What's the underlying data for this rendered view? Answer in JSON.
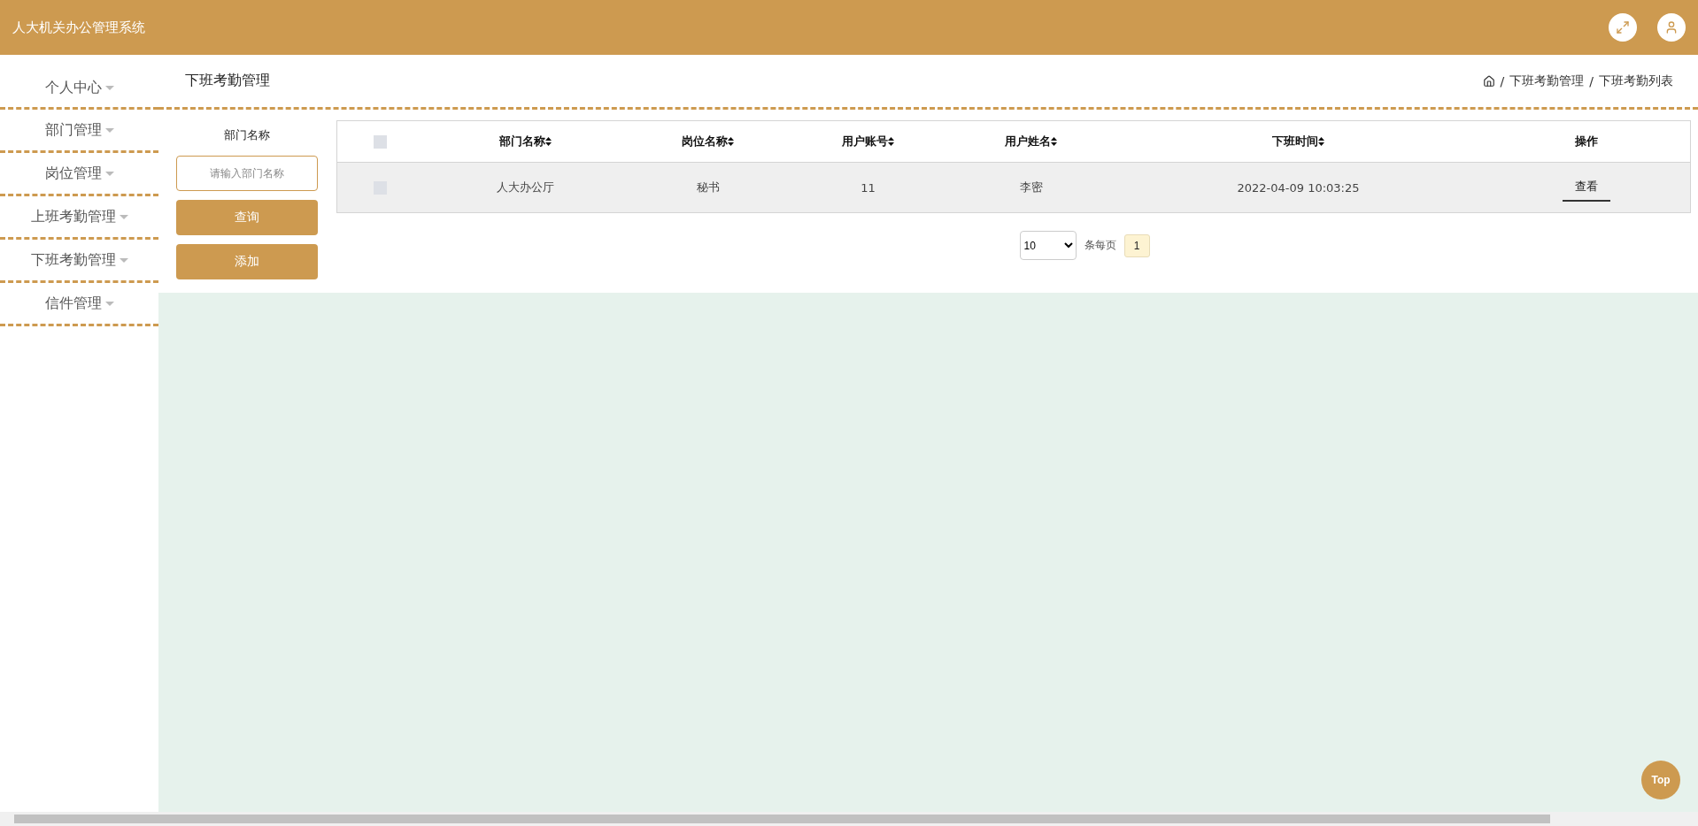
{
  "header": {
    "title": "人大机关办公管理系统"
  },
  "sidebar": {
    "items": [
      {
        "label": "个人中心"
      },
      {
        "label": "部门管理"
      },
      {
        "label": "岗位管理"
      },
      {
        "label": "上班考勤管理"
      },
      {
        "label": "下班考勤管理"
      },
      {
        "label": "信件管理"
      }
    ]
  },
  "page_title": "下班考勤管理",
  "breadcrumb": {
    "separator": "/",
    "items": [
      "下班考勤管理",
      "下班考勤列表"
    ]
  },
  "search": {
    "label": "部门名称",
    "placeholder": "请输入部门名称"
  },
  "buttons": [
    "查询",
    "添加"
  ],
  "table": {
    "header_checked": false,
    "columns": [
      {
        "label": "部门名称",
        "sortable": true
      },
      {
        "label": "岗位名称",
        "sortable": true
      },
      {
        "label": "用户账号",
        "sortable": true
      },
      {
        "label": "用户姓名",
        "sortable": true
      },
      {
        "label": "下班时间",
        "sortable": true
      },
      {
        "label": "操作",
        "sortable": false
      }
    ],
    "rows": [
      {
        "checked": false,
        "cells": [
          "人大办公厅",
          "秘书",
          "11",
          "李密",
          "2022-04-09 10:03:25"
        ],
        "action": "查看"
      }
    ]
  },
  "pagination": {
    "page_size": "10",
    "per_page_label": "条每页",
    "pages": [
      {
        "label": "1",
        "selected": true
      }
    ]
  },
  "back_to_top": "Top"
}
